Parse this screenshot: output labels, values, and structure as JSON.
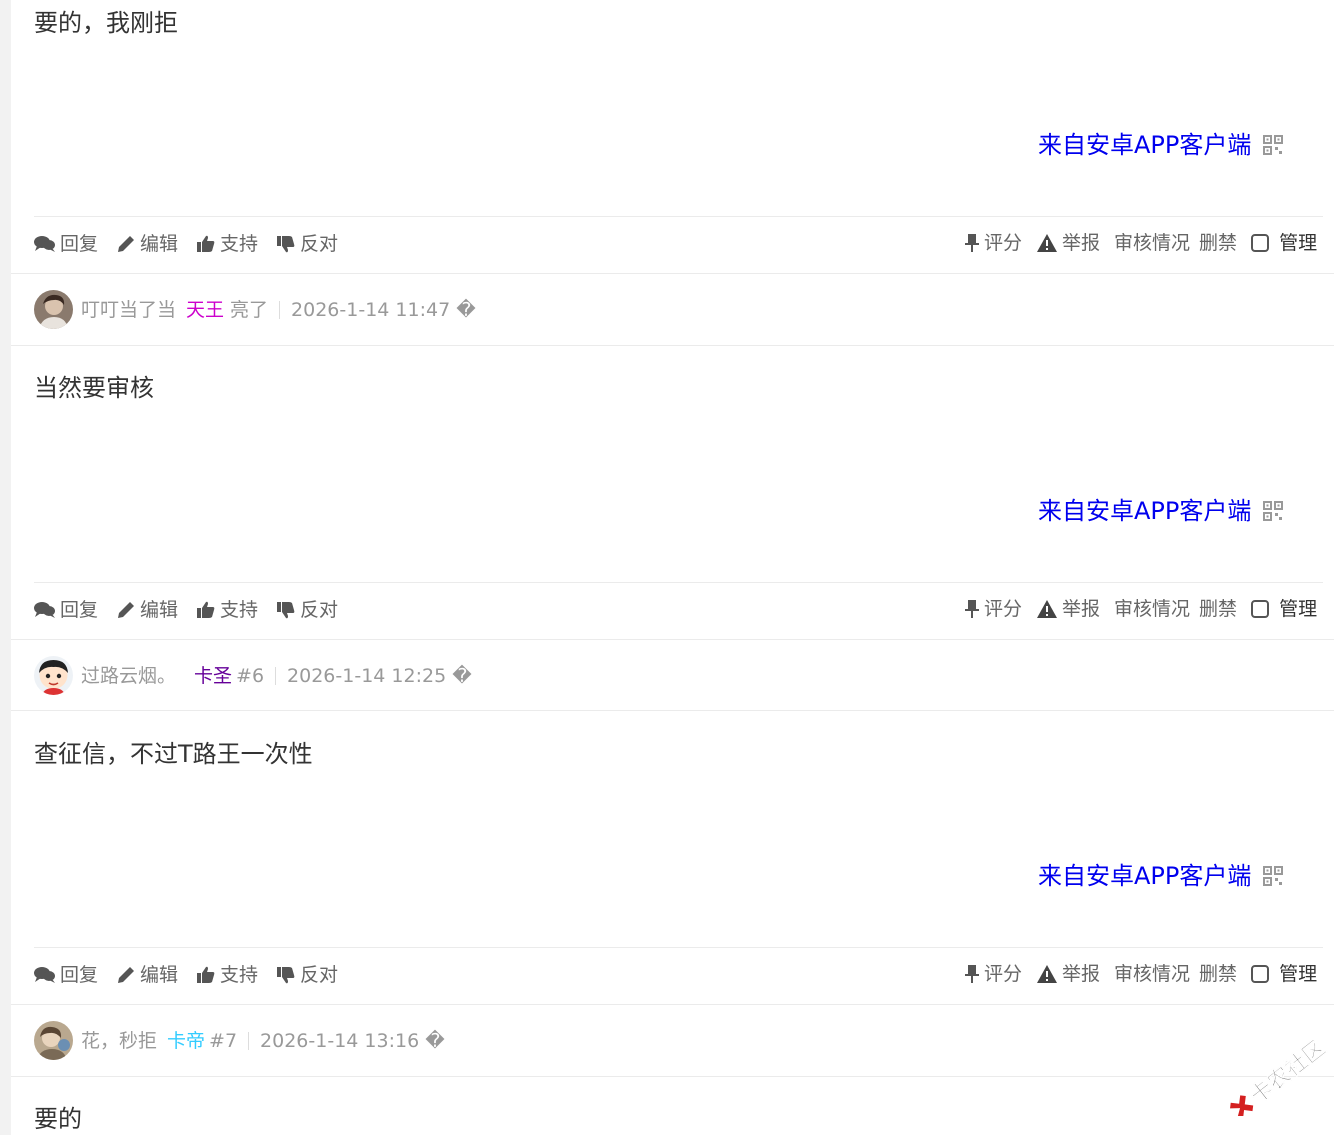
{
  "posts": [
    {
      "content": "要的，我刚拒",
      "source": "来自安卓APP客户端"
    },
    {
      "author": "叮叮当了当",
      "group": "天王",
      "group_color": "#cc00cc",
      "extra": "亮了",
      "time": "2026-1-14 11:47 �",
      "content": "当然要审核",
      "source": "来自安卓APP客户端"
    },
    {
      "author": "过路云烟。",
      "group": "卡圣",
      "group_color": "#660099",
      "extra": "#6",
      "time": "2026-1-14 12:25 �",
      "content": "查征信，不过T路王一次性",
      "source": "来自安卓APP客户端"
    },
    {
      "author": "花，秒拒",
      "group": "卡帝",
      "group_color": "#33ccff",
      "extra": "#7",
      "time": "2026-1-14 13:16 �",
      "content": "要的"
    }
  ],
  "actions": {
    "reply": "回复",
    "edit": "编辑",
    "support": "支持",
    "oppose": "反对",
    "rate": "评分",
    "report": "举报",
    "review": "审核情况",
    "ban": "删禁",
    "manage": "管理"
  },
  "watermark": "卡农社区",
  "colors": {
    "link": "#0000ee",
    "text": "#333333",
    "muted": "#999999",
    "action": "#666666"
  }
}
